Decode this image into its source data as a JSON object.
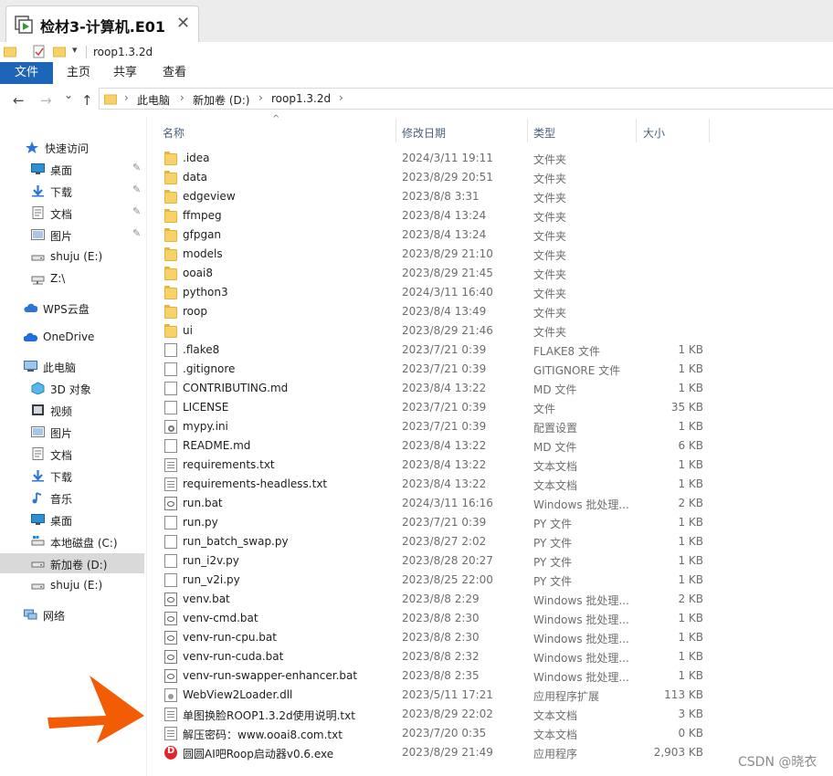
{
  "window": {
    "tab_title": "检材3-计算机.E01",
    "close_glyph": "✕"
  },
  "quick_access": {
    "path_label": "roop1.3.2d",
    "dropdown_glyph": "▾"
  },
  "ribbon": {
    "file": "文件",
    "home": "主页",
    "share": "共享",
    "view": "查看"
  },
  "nav": {
    "back": "←",
    "forward": "→",
    "recent": "⌄",
    "up": "↑"
  },
  "address": {
    "crumbs": [
      "此电脑",
      "新加卷 (D:)",
      "roop1.3.2d"
    ],
    "chevron": "›"
  },
  "sidebar": {
    "pin_glyph": "✎",
    "items": [
      {
        "label": "快速访问",
        "icon": "star-icon",
        "pinned": false,
        "selected": false
      },
      {
        "label": "桌面",
        "icon": "desktop-icon",
        "pinned": true,
        "selected": false
      },
      {
        "label": "下载",
        "icon": "download-icon",
        "pinned": true,
        "selected": false
      },
      {
        "label": "文档",
        "icon": "document-icon",
        "pinned": true,
        "selected": false
      },
      {
        "label": "图片",
        "icon": "pictures-icon",
        "pinned": true,
        "selected": false
      },
      {
        "label": "shuju (E:)",
        "icon": "drive-icon",
        "pinned": false,
        "selected": false
      },
      {
        "label": "Z:\\",
        "icon": "network-drive-icon",
        "pinned": false,
        "selected": false
      },
      {
        "label": "WPS云盘",
        "icon": "cloud-icon",
        "pinned": false,
        "selected": false
      },
      {
        "label": "OneDrive",
        "icon": "onedrive-icon",
        "pinned": false,
        "selected": false
      },
      {
        "label": "此电脑",
        "icon": "computer-icon",
        "pinned": false,
        "selected": false
      },
      {
        "label": "3D 对象",
        "icon": "3d-objects-icon",
        "pinned": false,
        "selected": false
      },
      {
        "label": "视频",
        "icon": "video-icon",
        "pinned": false,
        "selected": false
      },
      {
        "label": "图片",
        "icon": "pictures-icon",
        "pinned": false,
        "selected": false
      },
      {
        "label": "文档",
        "icon": "document-icon",
        "pinned": false,
        "selected": false
      },
      {
        "label": "下载",
        "icon": "download-icon",
        "pinned": false,
        "selected": false
      },
      {
        "label": "音乐",
        "icon": "music-icon",
        "pinned": false,
        "selected": false
      },
      {
        "label": "桌面",
        "icon": "desktop-icon",
        "pinned": false,
        "selected": false
      },
      {
        "label": "本地磁盘 (C:)",
        "icon": "system-drive-icon",
        "pinned": false,
        "selected": false
      },
      {
        "label": "新加卷 (D:)",
        "icon": "drive-icon",
        "pinned": false,
        "selected": true
      },
      {
        "label": "shuju (E:)",
        "icon": "drive-icon",
        "pinned": false,
        "selected": false
      },
      {
        "label": "网络",
        "icon": "network-icon",
        "pinned": false,
        "selected": false
      }
    ]
  },
  "columns": {
    "name": "名称",
    "date": "修改日期",
    "type": "类型",
    "size": "大小",
    "sort_glyph": "^"
  },
  "files": [
    {
      "name": ".idea",
      "date": "2024/3/11 19:11",
      "type": "文件夹",
      "size": "",
      "icon": "folder"
    },
    {
      "name": "data",
      "date": "2023/8/29 20:51",
      "type": "文件夹",
      "size": "",
      "icon": "folder"
    },
    {
      "name": "edgeview",
      "date": "2023/8/8 3:31",
      "type": "文件夹",
      "size": "",
      "icon": "folder"
    },
    {
      "name": "ffmpeg",
      "date": "2023/8/4 13:24",
      "type": "文件夹",
      "size": "",
      "icon": "folder"
    },
    {
      "name": "gfpgan",
      "date": "2023/8/4 13:24",
      "type": "文件夹",
      "size": "",
      "icon": "folder"
    },
    {
      "name": "models",
      "date": "2023/8/29 21:10",
      "type": "文件夹",
      "size": "",
      "icon": "folder"
    },
    {
      "name": "ooai8",
      "date": "2023/8/29 21:45",
      "type": "文件夹",
      "size": "",
      "icon": "folder"
    },
    {
      "name": "python3",
      "date": "2024/3/11 16:40",
      "type": "文件夹",
      "size": "",
      "icon": "folder"
    },
    {
      "name": "roop",
      "date": "2023/8/4 13:49",
      "type": "文件夹",
      "size": "",
      "icon": "folder"
    },
    {
      "name": "ui",
      "date": "2023/8/29 21:46",
      "type": "文件夹",
      "size": "",
      "icon": "folder"
    },
    {
      "name": ".flake8",
      "date": "2023/7/21 0:39",
      "type": "FLAKE8 文件",
      "size": "1 KB",
      "icon": "doc"
    },
    {
      "name": ".gitignore",
      "date": "2023/7/21 0:39",
      "type": "GITIGNORE 文件",
      "size": "1 KB",
      "icon": "doc"
    },
    {
      "name": "CONTRIBUTING.md",
      "date": "2023/8/4 13:22",
      "type": "MD 文件",
      "size": "1 KB",
      "icon": "doc"
    },
    {
      "name": "LICENSE",
      "date": "2023/7/21 0:39",
      "type": "文件",
      "size": "35 KB",
      "icon": "doc"
    },
    {
      "name": "mypy.ini",
      "date": "2023/7/21 0:39",
      "type": "配置设置",
      "size": "1 KB",
      "icon": "ini"
    },
    {
      "name": "README.md",
      "date": "2023/8/4 13:22",
      "type": "MD 文件",
      "size": "6 KB",
      "icon": "doc"
    },
    {
      "name": "requirements.txt",
      "date": "2023/8/4 13:22",
      "type": "文本文档",
      "size": "1 KB",
      "icon": "txt"
    },
    {
      "name": "requirements-headless.txt",
      "date": "2023/8/4 13:22",
      "type": "文本文档",
      "size": "1 KB",
      "icon": "txt"
    },
    {
      "name": "run.bat",
      "date": "2024/3/11 16:16",
      "type": "Windows 批处理...",
      "size": "2 KB",
      "icon": "bat"
    },
    {
      "name": "run.py",
      "date": "2023/7/21 0:39",
      "type": "PY 文件",
      "size": "1 KB",
      "icon": "doc"
    },
    {
      "name": "run_batch_swap.py",
      "date": "2023/8/27 2:02",
      "type": "PY 文件",
      "size": "1 KB",
      "icon": "doc"
    },
    {
      "name": "run_i2v.py",
      "date": "2023/8/28 20:27",
      "type": "PY 文件",
      "size": "1 KB",
      "icon": "doc"
    },
    {
      "name": "run_v2i.py",
      "date": "2023/8/25 22:00",
      "type": "PY 文件",
      "size": "1 KB",
      "icon": "doc"
    },
    {
      "name": "venv.bat",
      "date": "2023/8/8 2:29",
      "type": "Windows 批处理...",
      "size": "2 KB",
      "icon": "bat"
    },
    {
      "name": "venv-cmd.bat",
      "date": "2023/8/8 2:30",
      "type": "Windows 批处理...",
      "size": "1 KB",
      "icon": "bat"
    },
    {
      "name": "venv-run-cpu.bat",
      "date": "2023/8/8 2:30",
      "type": "Windows 批处理...",
      "size": "1 KB",
      "icon": "bat"
    },
    {
      "name": "venv-run-cuda.bat",
      "date": "2023/8/8 2:32",
      "type": "Windows 批处理...",
      "size": "1 KB",
      "icon": "bat"
    },
    {
      "name": "venv-run-swapper-enhancer.bat",
      "date": "2023/8/8 2:35",
      "type": "Windows 批处理...",
      "size": "1 KB",
      "icon": "bat"
    },
    {
      "name": "WebView2Loader.dll",
      "date": "2023/5/11 17:21",
      "type": "应用程序扩展",
      "size": "113 KB",
      "icon": "dll"
    },
    {
      "name": "单图换脸ROOP1.3.2d使用说明.txt",
      "date": "2023/8/29 22:02",
      "type": "文本文档",
      "size": "3 KB",
      "icon": "txt"
    },
    {
      "name": "解压密码：www.ooai8.com.txt",
      "date": "2023/7/20 0:35",
      "type": "文本文档",
      "size": "0 KB",
      "icon": "txt"
    },
    {
      "name": "圆圆AI吧Roop启动器v0.6.exe",
      "date": "2023/8/29 21:49",
      "type": "应用程序",
      "size": "2,903 KB",
      "icon": "exe"
    }
  ],
  "annotation": {
    "arrow_color": "#f25c05"
  },
  "watermark": "CSDN @晓衣"
}
